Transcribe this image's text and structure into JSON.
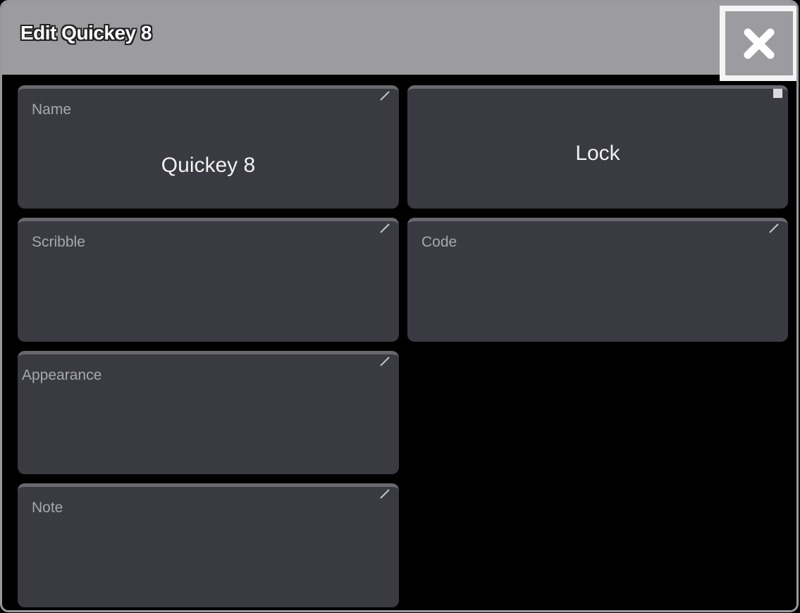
{
  "dialog": {
    "title": "Edit Quickey 8",
    "close_icon": "close-icon"
  },
  "fields": {
    "name": {
      "label": "Name",
      "value": "Quickey 8"
    },
    "lock": {
      "label": "Lock"
    },
    "scribble": {
      "label": "Scribble",
      "value": ""
    },
    "code": {
      "label": "Code",
      "value": ""
    },
    "appearance": {
      "label": "Appearance",
      "value": ""
    },
    "note": {
      "label": "Note",
      "value": ""
    }
  },
  "icons": {
    "edit": "pencil-edit-icon",
    "toggle": "toggle-indicator-icon"
  },
  "colors": {
    "title_bar": "#9c9ca0",
    "tile_background": "#3a3a42",
    "background": "#000000",
    "label_text": "#a8a8ae",
    "value_text": "#f2f2f2"
  }
}
